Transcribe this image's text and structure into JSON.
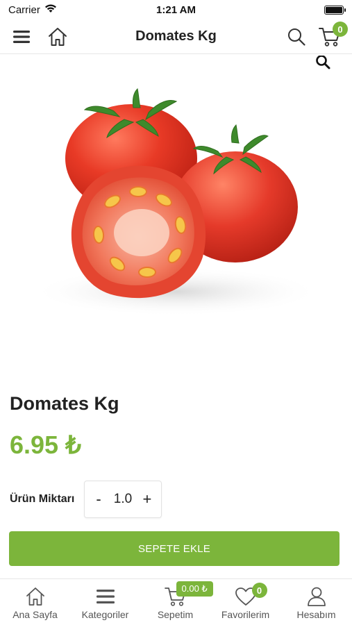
{
  "status_bar": {
    "carrier": "Carrier",
    "time": "1:21 AM"
  },
  "header": {
    "title": "Domates Kg",
    "cart_count": "0"
  },
  "product": {
    "name": "Domates Kg",
    "price": "6.95 ₺",
    "quantity_label": "Ürün Miktarı",
    "quantity_minus": "-",
    "quantity_value": "1.0",
    "quantity_plus": "+",
    "add_to_cart_label": "SEPETE EKLE"
  },
  "tab_bar": {
    "home_label": "Ana Sayfa",
    "categories_label": "Kategoriler",
    "cart_label": "Sepetim",
    "cart_total": "0.00 ₺",
    "favorites_label": "Favorilerim",
    "favorites_count": "0",
    "account_label": "Hesabım"
  },
  "colors": {
    "accent": "#7cb53b",
    "text": "#222222",
    "tomato": "#e53a2a"
  },
  "icons": [
    "wifi-icon",
    "battery-icon",
    "menu-icon",
    "home-icon",
    "search-icon",
    "cart-icon",
    "zoom-icon",
    "categories-icon",
    "heart-icon",
    "user-icon"
  ]
}
